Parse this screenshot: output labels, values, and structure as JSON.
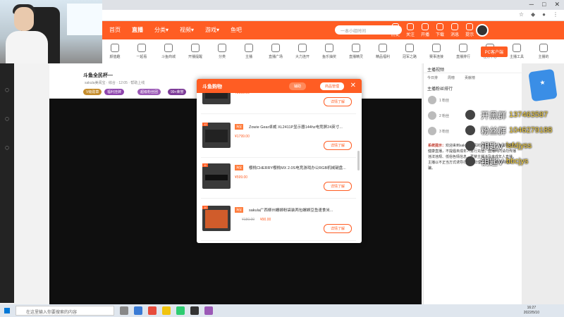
{
  "header": {
    "nav": [
      "首页",
      "直播",
      "分类▾",
      "视频▾",
      "游戏▾",
      "鱼吧"
    ],
    "search_placeholder": "一本小组时间",
    "icons": [
      "历史",
      "关注",
      "开播",
      "下载",
      "消息",
      "提示"
    ]
  },
  "categories": [
    "颜值趣",
    "一起看",
    "斗鱼商城",
    "开播提醒",
    "分类",
    "主播",
    "直播广场",
    "大力连开",
    "鱼乐抽奖",
    "直播精灵",
    "精品福利",
    "冠军之路",
    "赛事连接",
    "直播排行",
    "任务中心",
    "主播工具",
    "主播的"
  ],
  "pc_button": "PC客户端",
  "room": {
    "title": "斗鱼全民杯—",
    "subtitle": "sakula美阅宝  ·  综合  ·  12:05  ·  帮助上线",
    "tags": [
      "V级勋章",
      "福利挂牌",
      "超级粉丝团",
      "99+荣誉"
    ]
  },
  "chat": {
    "header": "主播视频",
    "tabs": [
      "今日排",
      "周榜",
      "贡献榜"
    ],
    "rank_label": "主播粉丝排行",
    "ranks": [
      "1 粉丝",
      "2 粉丝",
      "3 粉丝"
    ],
    "system_msg_label": "系统提示：",
    "system_msg": "欢迎来到sakula美阅的直播间，斗鱼倡导绿色健康直播，不提倡未成年人进行充值，直播间内请勿传播违法违规、低俗色情信息，严禁主播涉及未成年人直播，主播以不正当方式诱导打赏、非理性消费，警惕网络诈骗。"
  },
  "overlay": [
    {
      "label": "开黑群",
      "value": "137463587"
    },
    {
      "label": "粉丝群",
      "value": "1046279188"
    },
    {
      "label": "钥匙V",
      "value": "lsfdjyss"
    },
    {
      "label": "钥匙V",
      "value": "bbcjys"
    }
  ],
  "modal": {
    "title": "斗鱼购物",
    "btn1": "辅助",
    "btn2": "商品管理",
    "close": "✕",
    "items": [
      {
        "num": "",
        "tag": "",
        "title": "",
        "price": "¥2199.00",
        "old_price": "",
        "button": "详情了解"
      },
      {
        "num": "12",
        "tag": "淘宝",
        "title": "Zowie Gear卓威 XL2411P显示器144hz电竞屏24英寸...",
        "price": "¥1799.00",
        "old_price": "",
        "button": "详情了解"
      },
      {
        "num": "11",
        "tag": "淘宝",
        "title": "樱桃CHERRY樱桃MX 2.0S电竞游戏办公RGB机械键盘...",
        "price": "¥599.00",
        "old_price": "",
        "button": "详情了解"
      },
      {
        "num": "10",
        "tag": "淘宝",
        "title": "sakula广西柳州螺蛳粉袋装两包螺蛳豆鱼速食米...",
        "price": "¥90.00",
        "old_price": "¥180.00",
        "button": "详情了解"
      }
    ]
  },
  "taskbar": {
    "search": "在这里输入你要搜索的内容",
    "time": "16:27",
    "date": "2022/5/10"
  }
}
